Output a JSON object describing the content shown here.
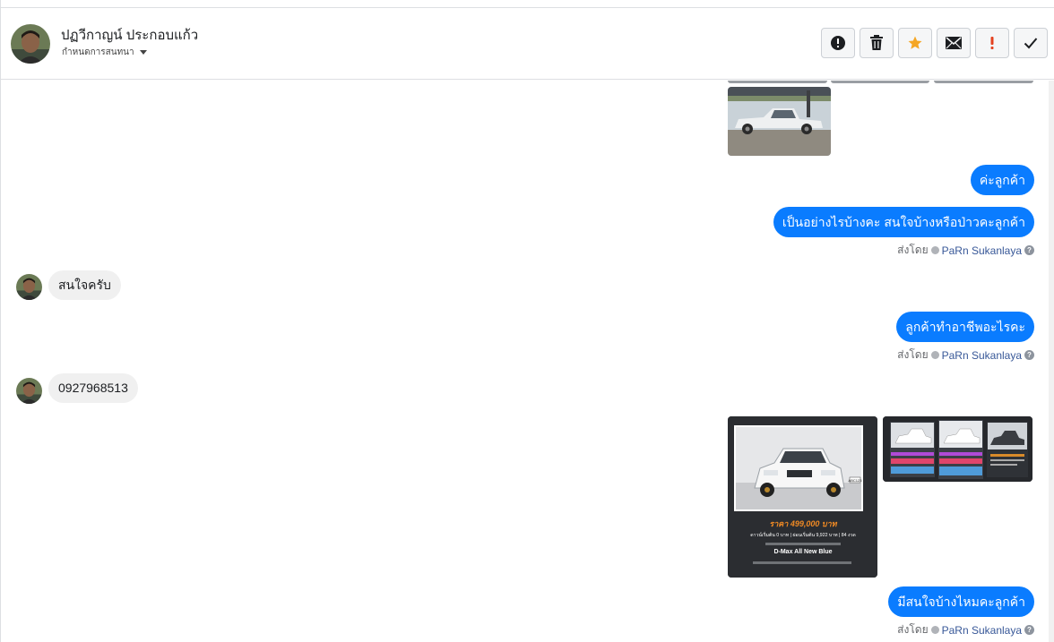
{
  "header": {
    "name": "ปฏวีกาญน์ ประกอบแก้ว",
    "subtitle": "กำหนดการสนทนา"
  },
  "actions": [
    {
      "icon": "alert-circle-icon"
    },
    {
      "icon": "trash-icon"
    },
    {
      "icon": "star-icon",
      "color": "#f5a623"
    },
    {
      "icon": "envelope-icon"
    },
    {
      "icon": "exclamation-icon",
      "color": "#e4411f"
    },
    {
      "icon": "checkmark-icon"
    }
  ],
  "messages": {
    "m1": "ค่ะลูกค้า",
    "m2": "เป็นอย่างไรบ้างคะ สนใจบ้างหรือป่าวคะลูกค้า",
    "m3": "สนใจครับ",
    "m4": "ลูกค้าทำอาชีพอะไรคะ",
    "m5": "0927968513",
    "m6": "มีสนใจบ้างไหมคะลูกค้า"
  },
  "sent_by": {
    "prefix": "ส่งโดย",
    "agent": "PaRn Sukanlaya"
  },
  "ad_card": {
    "price": "ราคา 499,000 บาท",
    "terms": "ดาวน์เริ่มต้น 0 บาท | ผ่อนเริ่มต้น 9,922 บาท | 84 งวด",
    "model": "D-Max All New Blue",
    "plate": "ABC123"
  },
  "colors": {
    "outgoing": "#0a7cff",
    "incoming": "#f0f0f0",
    "accent_price": "#f08a24"
  }
}
